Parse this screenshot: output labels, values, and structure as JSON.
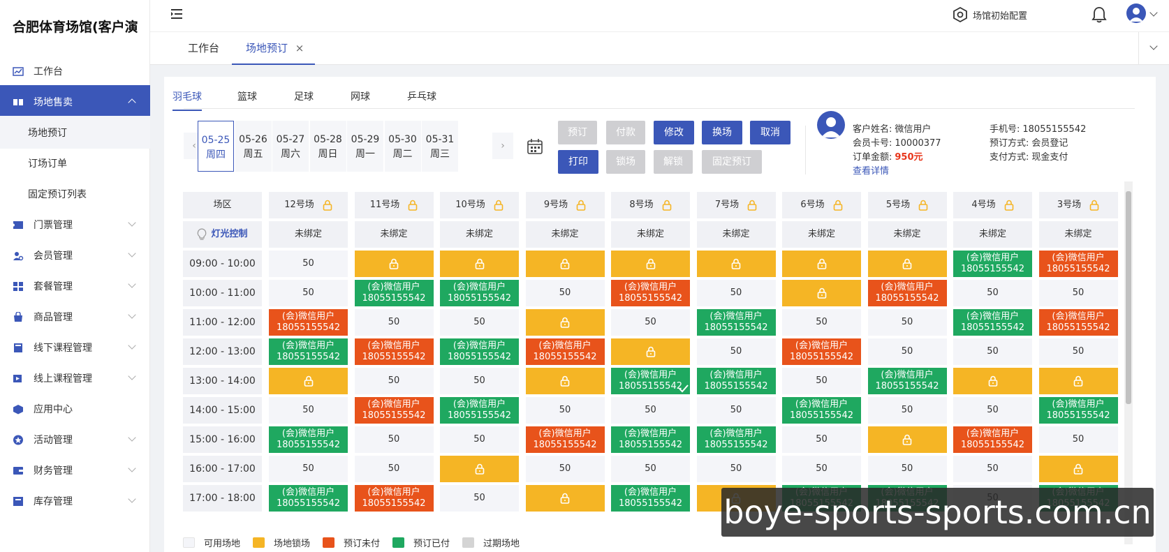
{
  "app": {
    "title": "合肥体育场馆(客户演"
  },
  "sidebar": {
    "items": [
      {
        "label": "工作台",
        "icon": "chart-icon",
        "expand": false
      },
      {
        "label": "场地售卖",
        "icon": "venue-icon",
        "expand": true,
        "active": true
      },
      {
        "label": "场地预订",
        "sub": true,
        "selected": true
      },
      {
        "label": "订场订单",
        "sub": true
      },
      {
        "label": "固定预订列表",
        "sub": true
      },
      {
        "label": "门票管理",
        "icon": "ticket-icon",
        "expand": true
      },
      {
        "label": "会员管理",
        "icon": "user-icon",
        "expand": true
      },
      {
        "label": "套餐管理",
        "icon": "package-icon",
        "expand": true
      },
      {
        "label": "商品管理",
        "icon": "bag-icon",
        "expand": true
      },
      {
        "label": "线下课程管理",
        "icon": "book-icon",
        "expand": true
      },
      {
        "label": "线上课程管理",
        "icon": "video-icon",
        "expand": true
      },
      {
        "label": "应用中心",
        "icon": "cube-icon",
        "expand": false
      },
      {
        "label": "活动管理",
        "icon": "star-icon",
        "expand": true
      },
      {
        "label": "财务管理",
        "icon": "finance-icon",
        "expand": true
      },
      {
        "label": "库存管理",
        "icon": "stock-icon",
        "expand": true
      }
    ]
  },
  "topbar": {
    "config_label": "场馆初始配置"
  },
  "page_tabs": [
    "工作台",
    "场地预订"
  ],
  "sport_tabs": [
    "羽毛球",
    "篮球",
    "足球",
    "网球",
    "乒乓球"
  ],
  "dates": [
    {
      "date": "05-25",
      "weekday": "周四",
      "active": true
    },
    {
      "date": "05-26",
      "weekday": "周五"
    },
    {
      "date": "05-27",
      "weekday": "周六"
    },
    {
      "date": "05-28",
      "weekday": "周日"
    },
    {
      "date": "05-29",
      "weekday": "周一"
    },
    {
      "date": "05-30",
      "weekday": "周二"
    },
    {
      "date": "05-31",
      "weekday": "周三"
    }
  ],
  "nav": {
    "prev": "‹",
    "next": "›"
  },
  "actions": {
    "book": "预订",
    "pay": "付款",
    "modify": "修改",
    "swap": "换场",
    "cancel": "取消",
    "print": "打印",
    "lock": "锁场",
    "unlock": "解锁",
    "fixed": "固定预订"
  },
  "customer": {
    "name_label": "客户姓名:",
    "name": "微信用户",
    "card_label": "会员卡号:",
    "card": "10000377",
    "amount_label": "订单金额:",
    "amount": "950元",
    "detail_link": "查看详情",
    "phone_label": "手机号:",
    "phone": "18055155542",
    "method_label": "预订方式:",
    "method": "会员登记",
    "pay_label": "支付方式:",
    "pay_method": "现金支付"
  },
  "grid": {
    "corner": "场区",
    "light_label": "灯光控制",
    "courts": [
      "12号场",
      "11号场",
      "10号场",
      "9号场",
      "8号场",
      "7号场",
      "6号场",
      "5号场",
      "4号场",
      "3号场"
    ],
    "binding": "未绑定",
    "booking_name": "(会)微信用户",
    "booking_phone": "18055155542",
    "price": "50",
    "times": [
      "09:00 - 10:00",
      "10:00 - 11:00",
      "11:00 - 12:00",
      "12:00 - 13:00",
      "13:00 - 14:00",
      "14:00 - 15:00",
      "15:00 - 16:00",
      "16:00 - 17:00",
      "17:00 - 18:00"
    ],
    "rows": [
      [
        "A",
        "L",
        "L",
        "L",
        "L",
        "L",
        "L",
        "L",
        "P",
        "U"
      ],
      [
        "A",
        "P",
        "P",
        "A",
        "U",
        "A",
        "L",
        "U",
        "A",
        "A"
      ],
      [
        "U",
        "A",
        "A",
        "L",
        "A",
        "P",
        "A",
        "A",
        "P",
        "U"
      ],
      [
        "P",
        "U",
        "P",
        "U",
        "L",
        "A",
        "U",
        "A",
        "A",
        "A"
      ],
      [
        "L",
        "A",
        "A",
        "L",
        "PS",
        "P",
        "A",
        "P",
        "L",
        "L"
      ],
      [
        "A",
        "U",
        "P",
        "A",
        "A",
        "A",
        "P",
        "A",
        "A",
        "P"
      ],
      [
        "P",
        "A",
        "A",
        "U",
        "P",
        "P",
        "A",
        "L",
        "U",
        "A"
      ],
      [
        "A",
        "A",
        "L",
        "A",
        "A",
        "A",
        "A",
        "A",
        "A",
        "L"
      ],
      [
        "P",
        "U",
        "A",
        "L",
        "P",
        "L",
        "P",
        "P",
        "A",
        "P"
      ]
    ]
  },
  "legend": [
    {
      "label": "可用场地",
      "color": "#f4f5f9"
    },
    {
      "label": "场地锁场",
      "color": "#f5b525"
    },
    {
      "label": "预订未付",
      "color": "#e8531b"
    },
    {
      "label": "预订已付",
      "color": "#1fa860"
    },
    {
      "label": "过期场地",
      "color": "#d4d4d4"
    }
  ],
  "watermark": "boye-sports-sports.com.cn"
}
